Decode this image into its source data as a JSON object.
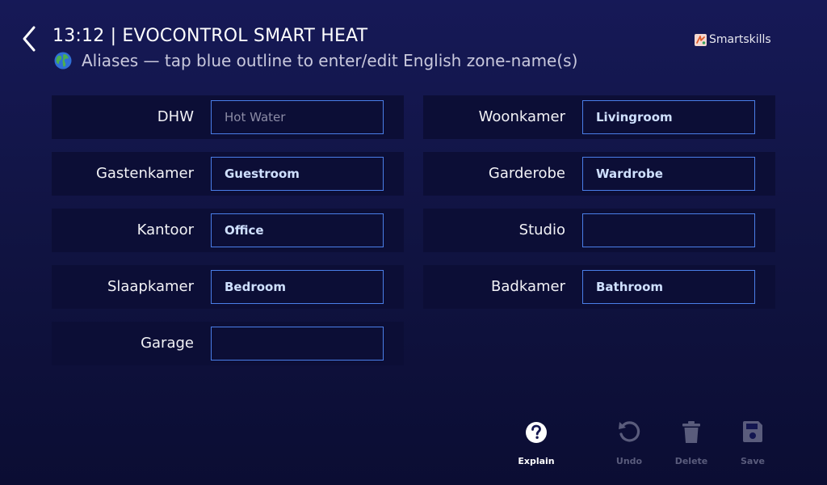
{
  "header": {
    "title": "13:12 | EVOCONTROL SMART HEAT",
    "subtitle": "Aliases — tap blue outline to enter/edit English zone-name(s)",
    "back_icon": "chevron-left-icon",
    "globe_icon": "globe-icon"
  },
  "brand": {
    "name": "Smartskills",
    "logo_icon": "smartskills-logo-icon"
  },
  "zones": [
    {
      "name": "DHW",
      "alias": "",
      "placeholder": "Hot Water"
    },
    {
      "name": "Woonkamer",
      "alias": "Livingroom",
      "placeholder": ""
    },
    {
      "name": "Gastenkamer",
      "alias": "Guestroom",
      "placeholder": ""
    },
    {
      "name": "Garderobe",
      "alias": "Wardrobe",
      "placeholder": ""
    },
    {
      "name": "Kantoor",
      "alias": "Office",
      "placeholder": ""
    },
    {
      "name": "Studio",
      "alias": "",
      "placeholder": ""
    },
    {
      "name": "Slaapkamer",
      "alias": "Bedroom",
      "placeholder": ""
    },
    {
      "name": "Badkamer",
      "alias": "Bathroom",
      "placeholder": ""
    },
    {
      "name": "Garage",
      "alias": "",
      "placeholder": ""
    }
  ],
  "actions": {
    "explain": {
      "label": "Explain",
      "icon": "help-circle-icon",
      "enabled": true
    },
    "undo": {
      "label": "Undo",
      "icon": "undo-icon",
      "enabled": false
    },
    "delete": {
      "label": "Delete",
      "icon": "trash-icon",
      "enabled": false
    },
    "save": {
      "label": "Save",
      "icon": "save-icon",
      "enabled": false
    }
  },
  "colors": {
    "background": "#131650",
    "row_background": "#0c0e36",
    "input_outline": "#4a7ee8",
    "input_text": "#cfe0ff",
    "disabled": "#5a5c7c"
  }
}
